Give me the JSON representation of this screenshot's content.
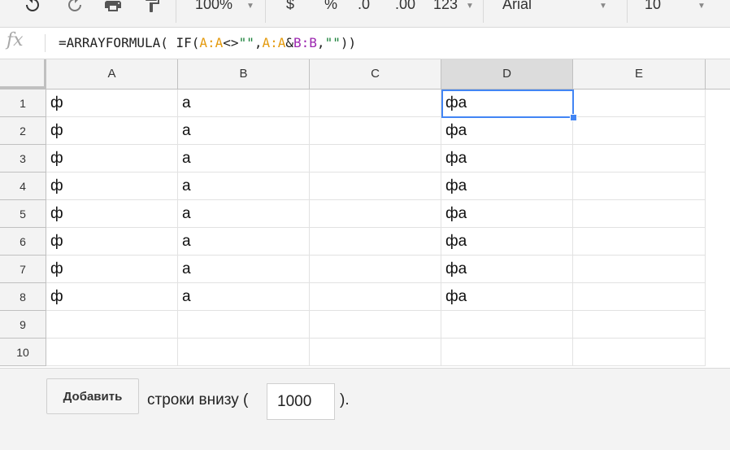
{
  "toolbar": {
    "zoom": "100%",
    "currency": "$",
    "percent": "%",
    "decrease_decimals": ".0",
    "increase_decimals": ".00",
    "more_formats": "123",
    "font": "Arial",
    "font_size": "10"
  },
  "formula_bar": {
    "fx_label": "fx",
    "parts": [
      "=ARRAYFORMULA( IF(",
      "A:A",
      "<>",
      "\"\"",
      ",",
      "A:A",
      "&",
      "B:B",
      ",",
      "\"\"",
      "))"
    ]
  },
  "columns": [
    "A",
    "B",
    "C",
    "D",
    "E"
  ],
  "selected_column": "D",
  "rows": [
    {
      "num": "1",
      "cells": [
        "ф",
        "а",
        "",
        "фа",
        ""
      ]
    },
    {
      "num": "2",
      "cells": [
        "ф",
        "а",
        "",
        "фа",
        ""
      ]
    },
    {
      "num": "3",
      "cells": [
        "ф",
        "а",
        "",
        "фа",
        ""
      ]
    },
    {
      "num": "4",
      "cells": [
        "ф",
        "а",
        "",
        "фа",
        ""
      ]
    },
    {
      "num": "5",
      "cells": [
        "ф",
        "а",
        "",
        "фа",
        ""
      ]
    },
    {
      "num": "6",
      "cells": [
        "ф",
        "а",
        "",
        "фа",
        ""
      ]
    },
    {
      "num": "7",
      "cells": [
        "ф",
        "а",
        "",
        "фа",
        ""
      ]
    },
    {
      "num": "8",
      "cells": [
        "ф",
        "а",
        "",
        "фа",
        ""
      ]
    },
    {
      "num": "9",
      "cells": [
        "",
        "",
        "",
        "",
        ""
      ]
    },
    {
      "num": "10",
      "cells": [
        "",
        "",
        "",
        "",
        ""
      ]
    }
  ],
  "bottom": {
    "add_button": "Добавить",
    "rows_label": "строки внизу (",
    "rows_value": "1000",
    "rows_suffix": ")."
  },
  "colors": {
    "selection": "#4285f4",
    "range_a": "#e49b0f",
    "range_b": "#9c27b0",
    "string": "#188038"
  }
}
